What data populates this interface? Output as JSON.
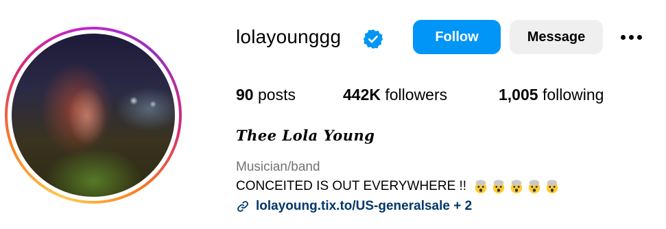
{
  "profile": {
    "username": "lolayounggg",
    "verified": true,
    "full_name": "Thee Lola Young",
    "category": "Musician/band",
    "bio": "CONCEITED IS OUT EVERYWHERE !!",
    "bio_emoji": [
      "exploding-head-emoji",
      "exploding-head-emoji",
      "exploding-head-emoji",
      "exploding-head-emoji",
      "exploding-head-emoji"
    ],
    "link": "lolayoung.tix.to/US-generalsale + 2"
  },
  "actions": {
    "follow_label": "Follow",
    "message_label": "Message",
    "more_icon": "more-options-icon"
  },
  "stats": {
    "posts_count": "90",
    "posts_label": "posts",
    "followers_count": "442K",
    "followers_label": "followers",
    "following_count": "1,005",
    "following_label": "following"
  },
  "colors": {
    "follow_button": "#0095f6",
    "message_button": "#efefef",
    "verified_badge": "#0095f6",
    "link": "#00376b",
    "category": "#737373"
  }
}
